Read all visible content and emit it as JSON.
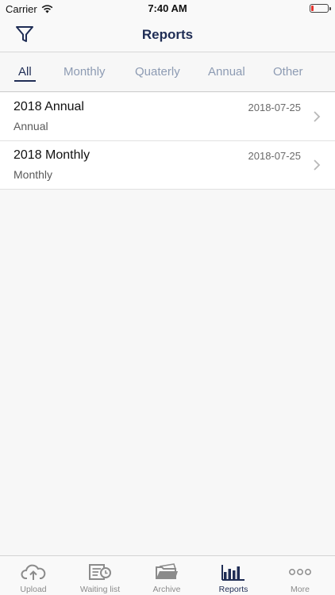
{
  "status_bar": {
    "carrier": "Carrier",
    "time": "7:40 AM"
  },
  "nav": {
    "title": "Reports"
  },
  "filter_tabs": [
    {
      "label": "All"
    },
    {
      "label": "Monthly"
    },
    {
      "label": "Quaterly"
    },
    {
      "label": "Annual"
    },
    {
      "label": "Other"
    }
  ],
  "reports": [
    {
      "title": "2018 Annual",
      "type": "Annual",
      "date": "2018-07-25"
    },
    {
      "title": "2018 Monthly",
      "type": "Monthly",
      "date": "2018-07-25"
    }
  ],
  "tab_bar": {
    "items": [
      {
        "label": "Upload",
        "icon": "cloud-upload-icon"
      },
      {
        "label": "Waiting list",
        "icon": "document-clock-icon"
      },
      {
        "label": "Archive",
        "icon": "archive-folder-icon"
      },
      {
        "label": "Reports",
        "icon": "bar-chart-icon"
      },
      {
        "label": "More",
        "icon": "more-dots-icon"
      }
    ]
  },
  "colors": {
    "primary": "#1f2d55",
    "inactive_tab": "#8d9bb3",
    "battery_low": "#e5352f"
  }
}
